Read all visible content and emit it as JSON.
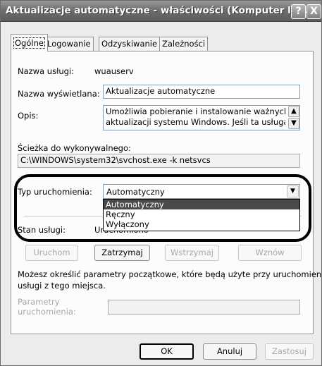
{
  "window": {
    "title": "Aktualizacje automatyczne - właściwości (Komputer lok...",
    "help_button": "?",
    "close_button": "X"
  },
  "tabs": [
    {
      "label": "Ogólne",
      "active": true
    },
    {
      "label": "Logowanie",
      "active": false
    },
    {
      "label": "Odzyskiwanie",
      "active": false
    },
    {
      "label": "Zależności",
      "active": false
    }
  ],
  "general": {
    "service_name_label": "Nazwa usługi:",
    "service_name_value": "wuauserv",
    "display_name_label": "Nazwa wyświetlana:",
    "display_name_value": "Aktualizacje automatyczne",
    "description_label": "Opis:",
    "description_line1": "Umożliwia pobieranie i instalowanie ważnych",
    "description_line2": "aktualizacji systemu Windows. Jeśli ta usługa jest",
    "path_label": "Ścieżka do wykonywalnego:",
    "path_value": "C:\\WINDOWS\\system32\\svchost.exe -k netsvcs",
    "startup_type_label": "Typ uruchomienia:",
    "startup_type_value": "Automatyczny",
    "startup_options": [
      "Automatyczny",
      "Ręczny",
      "Wyłączony"
    ],
    "status_label": "Stan usługi:",
    "status_value": "Uruchomiono",
    "start_button": "Uruchom",
    "stop_button": "Zatrzymaj",
    "pause_button": "Wstrzymaj",
    "resume_button": "Wznów",
    "params_hint": "Możesz określić parametry początkowe, które będą użyte przy uruchomieniu usługi z tego miejsca.",
    "params_hint_line1": "Możesz określić parametry początkowe, które będą użyte przy uruchomieniu",
    "params_hint_line2": "usługi z tego miejsca.",
    "params_label_line1": "Parametry",
    "params_label_line2": "uruchomienia:",
    "params_value": ""
  },
  "footer": {
    "ok_button": "OK",
    "cancel_button": "Anuluj",
    "apply_button": "Zastosuj"
  },
  "colors": {
    "selection": "#4a4a4a",
    "title_bar": "#6e6e6e",
    "panel_bg": "#fcfcfc"
  }
}
